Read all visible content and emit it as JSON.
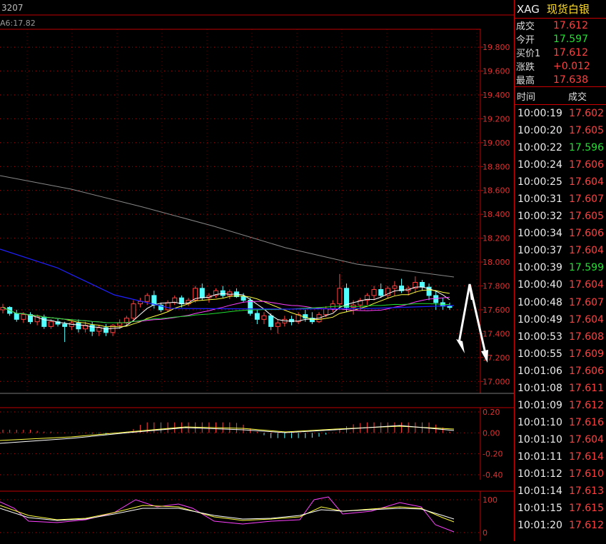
{
  "header": {
    "code": "3207",
    "ma_label": "A6:17.82"
  },
  "axis": {
    "price_ticks": [
      "19.800",
      "19.600",
      "19.400",
      "19.200",
      "19.000",
      "18.800",
      "18.600",
      "18.400",
      "18.200",
      "18.000",
      "17.800",
      "17.600",
      "17.400",
      "17.200",
      "17.000"
    ],
    "macd_ticks": [
      "0.20",
      "0.00",
      "-0.20",
      "-0.40"
    ],
    "kdj_ticks": [
      "100",
      "0"
    ]
  },
  "quote": {
    "symbol": "XAG",
    "name": "现货白银",
    "rows": [
      {
        "label": "成交",
        "value": "17.612",
        "color": "red"
      },
      {
        "label": "今开",
        "value": "17.597",
        "color": "green"
      },
      {
        "label": "买价1",
        "value": "17.612",
        "color": "red"
      },
      {
        "label": "涨跌",
        "value": "+0.012",
        "color": "red"
      },
      {
        "label": "最高",
        "value": "17.638",
        "color": "red"
      }
    ]
  },
  "ticks": {
    "header_time": "时间",
    "header_price": "成交",
    "rows": [
      {
        "time": "10:00:19",
        "price": "17.602",
        "color": "red"
      },
      {
        "time": "10:00:20",
        "price": "17.605",
        "color": "red"
      },
      {
        "time": "10:00:22",
        "price": "17.596",
        "color": "green"
      },
      {
        "time": "10:00:24",
        "price": "17.606",
        "color": "red"
      },
      {
        "time": "10:00:25",
        "price": "17.604",
        "color": "red"
      },
      {
        "time": "10:00:31",
        "price": "17.607",
        "color": "red"
      },
      {
        "time": "10:00:32",
        "price": "17.605",
        "color": "red"
      },
      {
        "time": "10:00:34",
        "price": "17.606",
        "color": "red"
      },
      {
        "time": "10:00:37",
        "price": "17.604",
        "color": "red"
      },
      {
        "time": "10:00:39",
        "price": "17.599",
        "color": "green"
      },
      {
        "time": "10:00:40",
        "price": "17.604",
        "color": "red"
      },
      {
        "time": "10:00:48",
        "price": "17.607",
        "color": "red"
      },
      {
        "time": "10:00:49",
        "price": "17.604",
        "color": "red"
      },
      {
        "time": "10:00:53",
        "price": "17.608",
        "color": "red"
      },
      {
        "time": "10:00:55",
        "price": "17.609",
        "color": "red"
      },
      {
        "time": "10:01:06",
        "price": "17.606",
        "color": "red"
      },
      {
        "time": "10:01:08",
        "price": "17.611",
        "color": "red"
      },
      {
        "time": "10:01:09",
        "price": "17.612",
        "color": "red"
      },
      {
        "time": "10:01:10",
        "price": "17.616",
        "color": "red"
      },
      {
        "time": "10:01:10",
        "price": "17.604",
        "color": "red"
      },
      {
        "time": "10:01:11",
        "price": "17.614",
        "color": "red"
      },
      {
        "time": "10:01:12",
        "price": "17.610",
        "color": "red"
      },
      {
        "time": "10:01:14",
        "price": "17.613",
        "color": "red"
      },
      {
        "time": "10:01:15",
        "price": "17.615",
        "color": "red"
      },
      {
        "time": "10:01:20",
        "price": "17.612",
        "color": "red"
      }
    ]
  },
  "colors": {
    "up": "#ff4040",
    "down": "#20e030",
    "grid": "#c00000",
    "candle_down": "#54ffff"
  },
  "chart_data": {
    "type": "candlestick",
    "ylim": [
      16.9,
      19.95
    ],
    "candles": [
      [
        17.6,
        17.65,
        17.57,
        17.62
      ],
      [
        17.62,
        17.63,
        17.55,
        17.57
      ],
      [
        17.57,
        17.6,
        17.5,
        17.52
      ],
      [
        17.52,
        17.58,
        17.49,
        17.56
      ],
      [
        17.56,
        17.58,
        17.48,
        17.5
      ],
      [
        17.5,
        17.56,
        17.47,
        17.54
      ],
      [
        17.54,
        17.56,
        17.44,
        17.46
      ],
      [
        17.46,
        17.52,
        17.44,
        17.5
      ],
      [
        17.5,
        17.53,
        17.46,
        17.48
      ],
      [
        17.48,
        17.5,
        17.33,
        17.46
      ],
      [
        17.46,
        17.51,
        17.43,
        17.49
      ],
      [
        17.49,
        17.52,
        17.41,
        17.44
      ],
      [
        17.44,
        17.5,
        17.41,
        17.47
      ],
      [
        17.47,
        17.5,
        17.38,
        17.42
      ],
      [
        17.42,
        17.47,
        17.38,
        17.45
      ],
      [
        17.45,
        17.48,
        17.38,
        17.41
      ],
      [
        17.41,
        17.48,
        17.38,
        17.47
      ],
      [
        17.47,
        17.52,
        17.44,
        17.49
      ],
      [
        17.49,
        17.55,
        17.46,
        17.53
      ],
      [
        17.53,
        17.68,
        17.5,
        17.65
      ],
      [
        17.65,
        17.7,
        17.62,
        17.67
      ],
      [
        17.67,
        17.74,
        17.64,
        17.72
      ],
      [
        17.72,
        17.76,
        17.61,
        17.64
      ],
      [
        17.64,
        17.66,
        17.58,
        17.6
      ],
      [
        17.6,
        17.68,
        17.58,
        17.66
      ],
      [
        17.66,
        17.72,
        17.64,
        17.7
      ],
      [
        17.7,
        17.72,
        17.62,
        17.65
      ],
      [
        17.65,
        17.7,
        17.63,
        17.68
      ],
      [
        17.68,
        17.8,
        17.66,
        17.78
      ],
      [
        17.78,
        17.82,
        17.68,
        17.7
      ],
      [
        17.7,
        17.74,
        17.66,
        17.72
      ],
      [
        17.72,
        17.78,
        17.7,
        17.76
      ],
      [
        17.76,
        17.8,
        17.7,
        17.72
      ],
      [
        17.72,
        17.77,
        17.69,
        17.75
      ],
      [
        17.75,
        17.78,
        17.7,
        17.71
      ],
      [
        17.71,
        17.74,
        17.66,
        17.68
      ],
      [
        17.68,
        17.7,
        17.55,
        17.57
      ],
      [
        17.57,
        17.6,
        17.48,
        17.52
      ],
      [
        17.52,
        17.58,
        17.48,
        17.55
      ],
      [
        17.55,
        17.57,
        17.43,
        17.46
      ],
      [
        17.46,
        17.52,
        17.4,
        17.49
      ],
      [
        17.49,
        17.55,
        17.46,
        17.52
      ],
      [
        17.52,
        17.55,
        17.47,
        17.5
      ],
      [
        17.5,
        17.58,
        17.48,
        17.56
      ],
      [
        17.56,
        17.6,
        17.5,
        17.53
      ],
      [
        17.53,
        17.58,
        17.48,
        17.5
      ],
      [
        17.5,
        17.58,
        17.49,
        17.56
      ],
      [
        17.56,
        17.63,
        17.54,
        17.61
      ],
      [
        17.61,
        17.68,
        17.58,
        17.65
      ],
      [
        17.65,
        17.9,
        17.62,
        17.78
      ],
      [
        17.78,
        17.82,
        17.58,
        17.62
      ],
      [
        17.62,
        17.68,
        17.56,
        17.64
      ],
      [
        17.64,
        17.7,
        17.6,
        17.68
      ],
      [
        17.68,
        17.74,
        17.64,
        17.72
      ],
      [
        17.72,
        17.8,
        17.68,
        17.77
      ],
      [
        17.77,
        17.82,
        17.7,
        17.72
      ],
      [
        17.72,
        17.8,
        17.7,
        17.78
      ],
      [
        17.78,
        17.84,
        17.72,
        17.8
      ],
      [
        17.8,
        17.86,
        17.74,
        17.76
      ],
      [
        17.76,
        17.8,
        17.72,
        17.78
      ],
      [
        17.78,
        17.88,
        17.74,
        17.83
      ],
      [
        17.83,
        17.85,
        17.76,
        17.79
      ],
      [
        17.79,
        17.82,
        17.68,
        17.72
      ],
      [
        17.72,
        17.76,
        17.6,
        17.66
      ],
      [
        17.66,
        17.7,
        17.6,
        17.63
      ],
      [
        17.63,
        17.66,
        17.6,
        17.62
      ]
    ]
  }
}
